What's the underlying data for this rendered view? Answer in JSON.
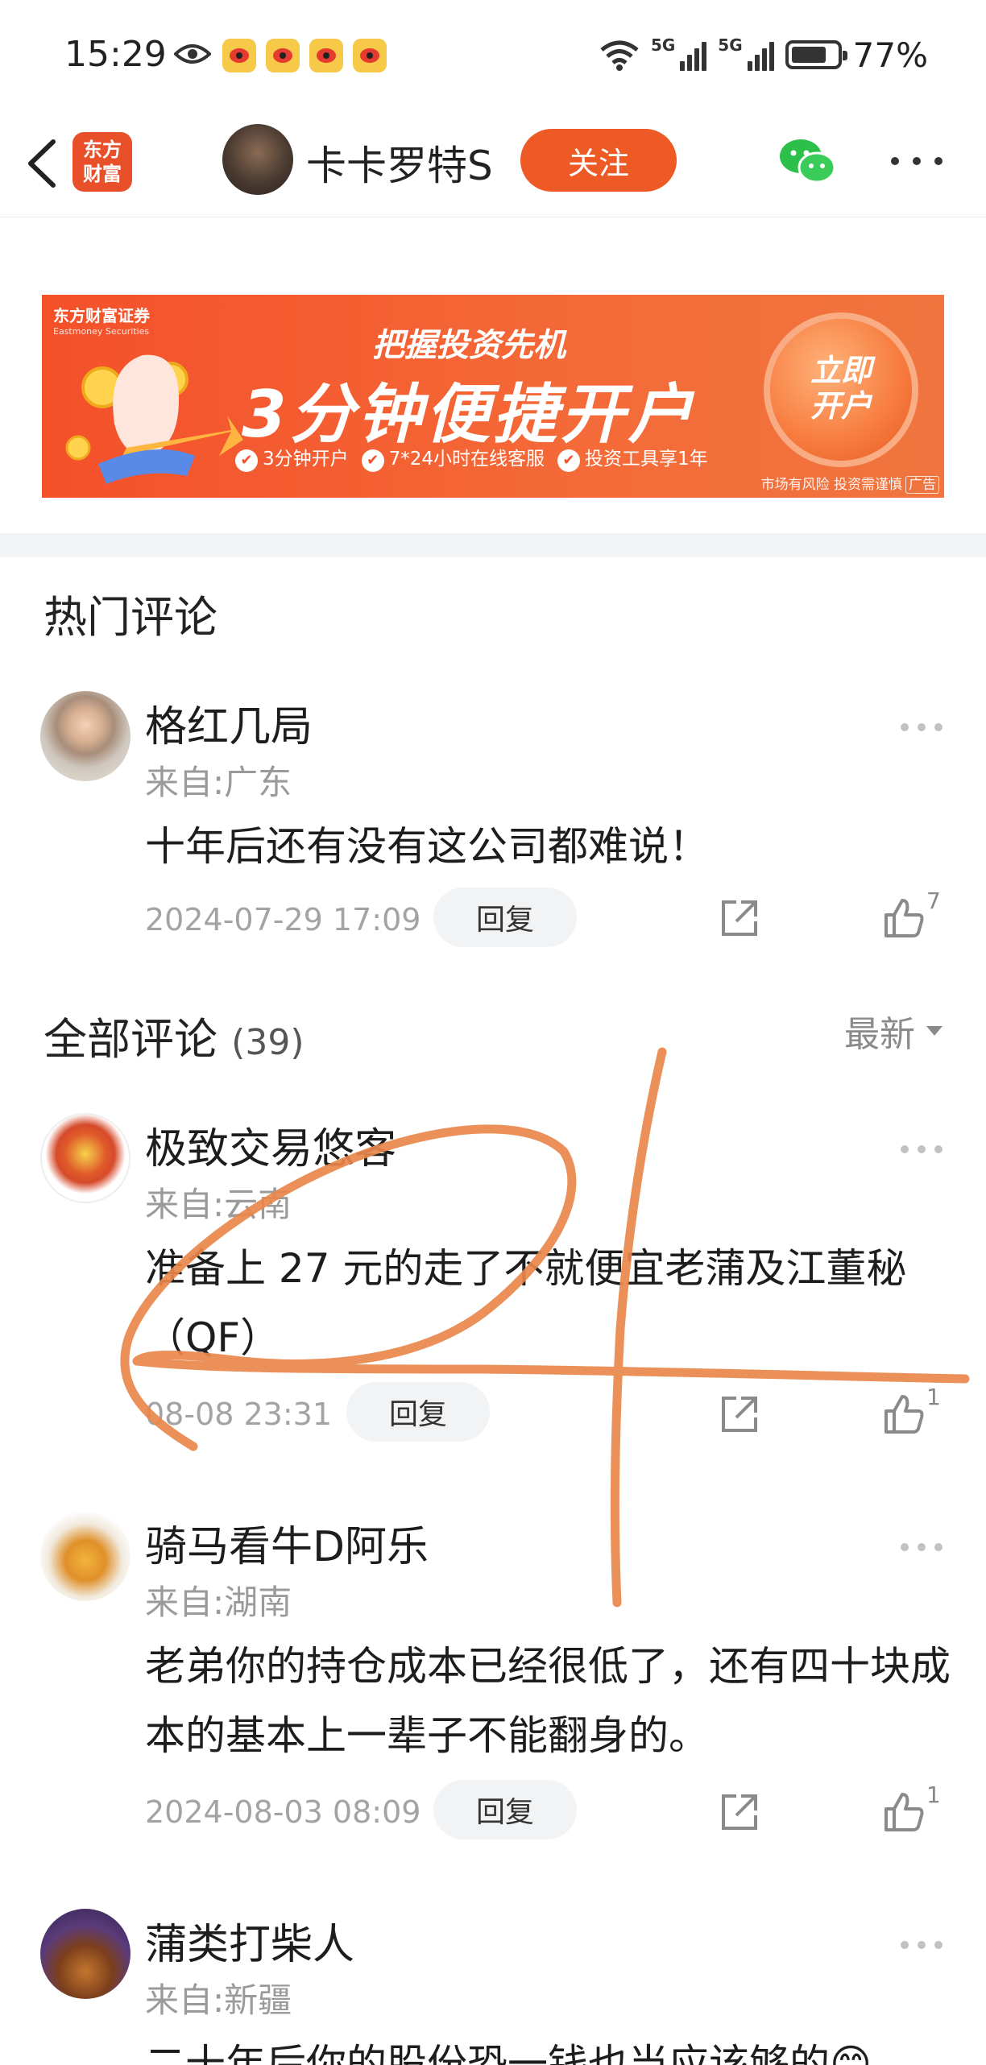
{
  "status_bar": {
    "time": "15:29",
    "network1": "5G",
    "network2": "5G",
    "battery_pct": "77%",
    "battery_level": 0.77,
    "notification_icons": [
      "eye-icon",
      "weibo-icon",
      "weibo-icon",
      "weibo-icon",
      "weibo-icon"
    ]
  },
  "header": {
    "logo_line1": "东方",
    "logo_line2": "财富",
    "author_name": "卡卡罗特S",
    "follow_label": "关注"
  },
  "ad": {
    "brand": "东方财富证券",
    "brand_en": "Eastmoney Securities",
    "headline1": "把握投资先机",
    "headline2": "3分钟便捷开户",
    "points": [
      "3分钟开户",
      "7*24小时在线客服",
      "投资工具享1年"
    ],
    "cta_line1": "立即",
    "cta_line2": "开户",
    "disclaimer": "市场有风险 投资需谨慎",
    "ad_tag": "广告"
  },
  "hot_comments": {
    "title": "热门评论",
    "items": [
      {
        "name": "格红几局",
        "location": "来自:广东",
        "text": "十年后还有没有这公司都难说！",
        "time": "2024-07-29 17:09",
        "reply_label": "回复",
        "likes": "7"
      }
    ]
  },
  "all_comments": {
    "title": "全部评论",
    "count": "(39)",
    "sort_label": "最新",
    "items": [
      {
        "name": "极致交易悠客",
        "location": "来自:云南",
        "text": "准备上 27 元的走了不就便宜老蒲及江董秘（QF）",
        "time": "08-08 23:31",
        "reply_label": "回复",
        "likes": "1"
      },
      {
        "name": "骑马看牛D阿乐",
        "location": "来自:湖南",
        "text": "老弟你的持仓成本已经很低了，还有四十块成本的基本上一辈子不能翻身的。",
        "time": "2024-08-03 08:09",
        "reply_label": "回复",
        "likes": "1"
      },
      {
        "name": "蒲类打柴人",
        "location": "来自:新疆",
        "text": "二十年后你的股份恐一钱也当应该够的😊",
        "time": "",
        "reply_label": "",
        "likes": ""
      }
    ]
  },
  "colors": {
    "accent": "#ee5a26",
    "annotation_stroke": "#e9874a"
  }
}
